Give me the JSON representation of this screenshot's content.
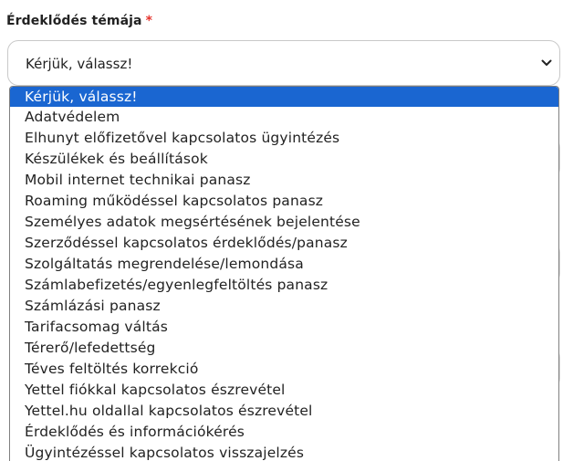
{
  "form": {
    "label": "Érdeklődés témája",
    "required_mark": "*",
    "select_value": "Kérjük, válassz!",
    "chevron_icon": "chevron-down-icon"
  },
  "dropdown": {
    "options": [
      "Kérjük, válassz!",
      "Adatvédelem",
      "Elhunyt előfizetővel kapcsolatos ügyintézés",
      "Készülékek és beállítások",
      "Mobil internet technikai panasz",
      "Roaming működéssel kapcsolatos panasz",
      "Személyes adatok megsértésének bejelentése",
      "Szerződéssel kapcsolatos érdeklődés/panasz",
      "Szolgáltatás megrendelése/lemondása",
      "Számlabefizetés/egyenlegfeltöltés panasz",
      "Számlázási panasz",
      "Tarifacsomag váltás",
      "Térerő/lefedettség",
      "Téves feltöltés korrekció",
      "Yettel fiókkal kapcsolatos észrevétel",
      "Yettel.hu oldallal kapcsolatos észrevétel",
      "Érdeklődés és információkérés",
      "Ügyintézéssel kapcsolatos visszajelzés"
    ],
    "selected_index": 0
  },
  "colors": {
    "highlight": "#1a66d1",
    "required": "#e5342d",
    "border": "#c9c9c9"
  }
}
